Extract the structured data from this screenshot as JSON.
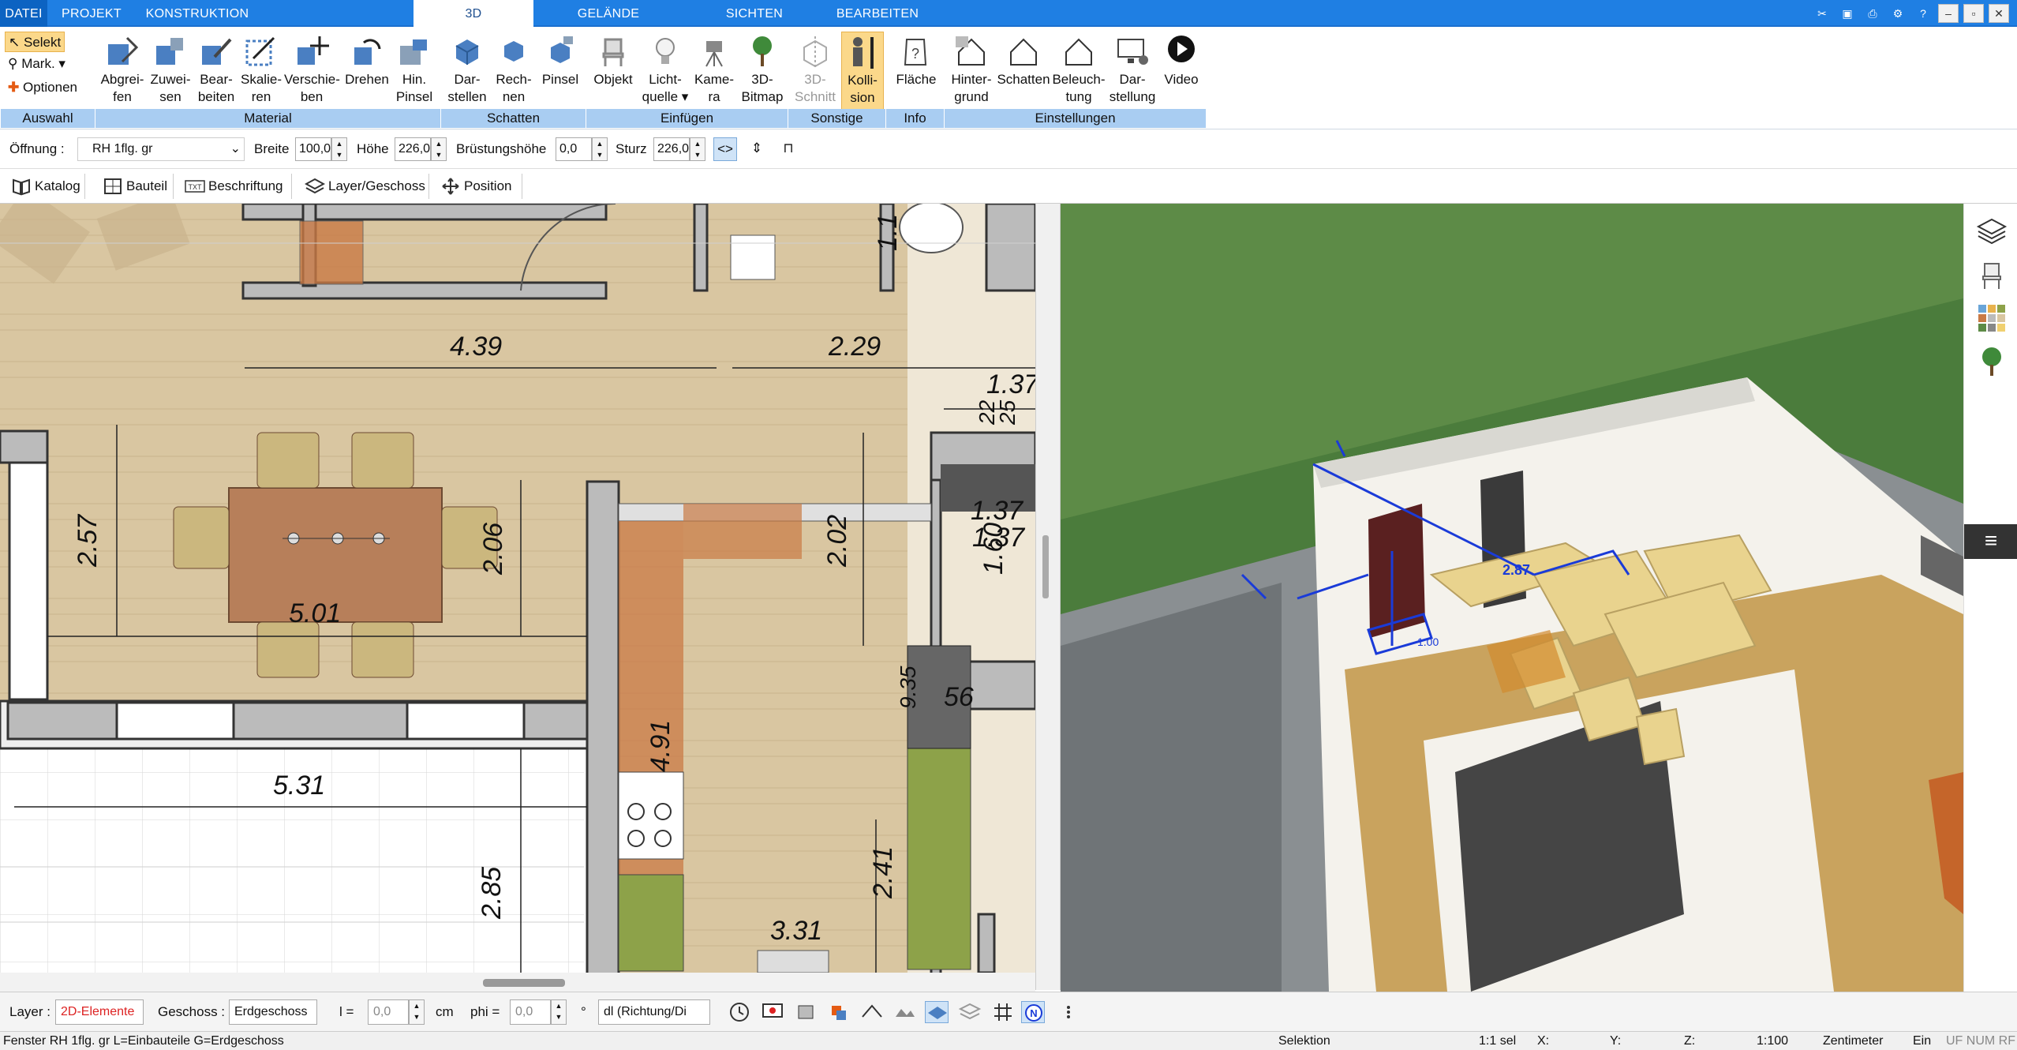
{
  "menu": {
    "tabs": [
      "DATEI",
      "PROJEKT",
      "KONSTRUKTION",
      "3D",
      "GELÄNDE",
      "SICHTEN",
      "BEARBEITEN"
    ],
    "active": "3D"
  },
  "ribbon": {
    "auswahl": {
      "selekt": "Selekt",
      "mark": "Mark.",
      "optionen": "Optionen",
      "group": "Auswahl"
    },
    "material": {
      "buttons": [
        [
          "Abgrei-",
          "fen"
        ],
        [
          "Zuwei-",
          "sen"
        ],
        [
          "Bear-",
          "beiten"
        ],
        [
          "Skalie-",
          "ren"
        ],
        [
          "Verschie-",
          "ben"
        ],
        [
          "Drehen",
          ""
        ],
        [
          "Hin.",
          "Pinsel"
        ]
      ],
      "group": "Material"
    },
    "schatten": {
      "buttons": [
        [
          "Dar-",
          "stellen"
        ],
        [
          "Rech-",
          "nen"
        ],
        [
          "Pinsel",
          ""
        ]
      ],
      "group": "Schatten"
    },
    "einfuegen": {
      "buttons": [
        [
          "Objekt",
          ""
        ],
        [
          "Licht-",
          "quelle"
        ],
        [
          "Kame-",
          "ra"
        ],
        [
          "3D-",
          "Bitmap"
        ]
      ],
      "group": "Einfügen"
    },
    "sonstige": {
      "buttons": [
        [
          "3D-",
          "Schnitt"
        ],
        [
          "Kolli-",
          "sion"
        ]
      ],
      "group": "Sonstige"
    },
    "info": {
      "buttons": [
        [
          "Fläche",
          ""
        ]
      ],
      "group": "Info"
    },
    "einstellungen": {
      "buttons": [
        [
          "Hinter-",
          "grund"
        ],
        [
          "Schatten",
          ""
        ],
        [
          "Beleuch-",
          "tung"
        ],
        [
          "Dar-",
          "stellung"
        ],
        [
          "Video",
          ""
        ]
      ],
      "group": "Einstellungen"
    }
  },
  "props": {
    "oeffnung_label": "Öffnung :",
    "oeffnung_value": "RH 1flg. gr",
    "breite_label": "Breite",
    "breite_value": "100,0",
    "hoehe_label": "Höhe",
    "hoehe_value": "226,0",
    "bruestung_label": "Brüstungshöhe",
    "bruestung_value": "0,0",
    "sturz_label": "Sturz",
    "sturz_value": "226,0"
  },
  "tabs": {
    "katalog": "Katalog",
    "bauteil": "Bauteil",
    "beschriftung": "Beschriftung",
    "layer": "Layer/Geschoss",
    "position": "Position"
  },
  "plan": {
    "dims": [
      "4.39",
      "2.29",
      "1.37",
      "2.57",
      "5.01",
      "2.06",
      "2.02",
      "1.37",
      "1.60",
      "1.37",
      "22",
      "25",
      "5.31",
      "4.91",
      "9.35",
      "56",
      "2.85",
      "2.41",
      "3.31",
      "1.1"
    ]
  },
  "view3d": {
    "labels": [
      "2.87",
      "1.00"
    ]
  },
  "bottom": {
    "layer_label": "Layer :",
    "layer_value": "2D-Elemente",
    "geschoss_label": "Geschoss :",
    "geschoss_value": "Erdgeschoss",
    "l_label": "l =",
    "l_value": "0,0",
    "l_unit": "cm",
    "phi_label": "phi =",
    "phi_value": "0,0",
    "phi_unit": "°",
    "dl_value": "dl (Richtung/Di"
  },
  "status": {
    "info": "Fenster RH 1flg. gr L=Einbauteile G=Erdgeschoss",
    "mode": "Selektion",
    "sel": "1:1 sel",
    "x": "X:",
    "y": "Y:",
    "z": "Z:",
    "scale": "1:100",
    "unit": "Zentimeter",
    "ein": "Ein",
    "flags": "UF  NUM  RF"
  }
}
